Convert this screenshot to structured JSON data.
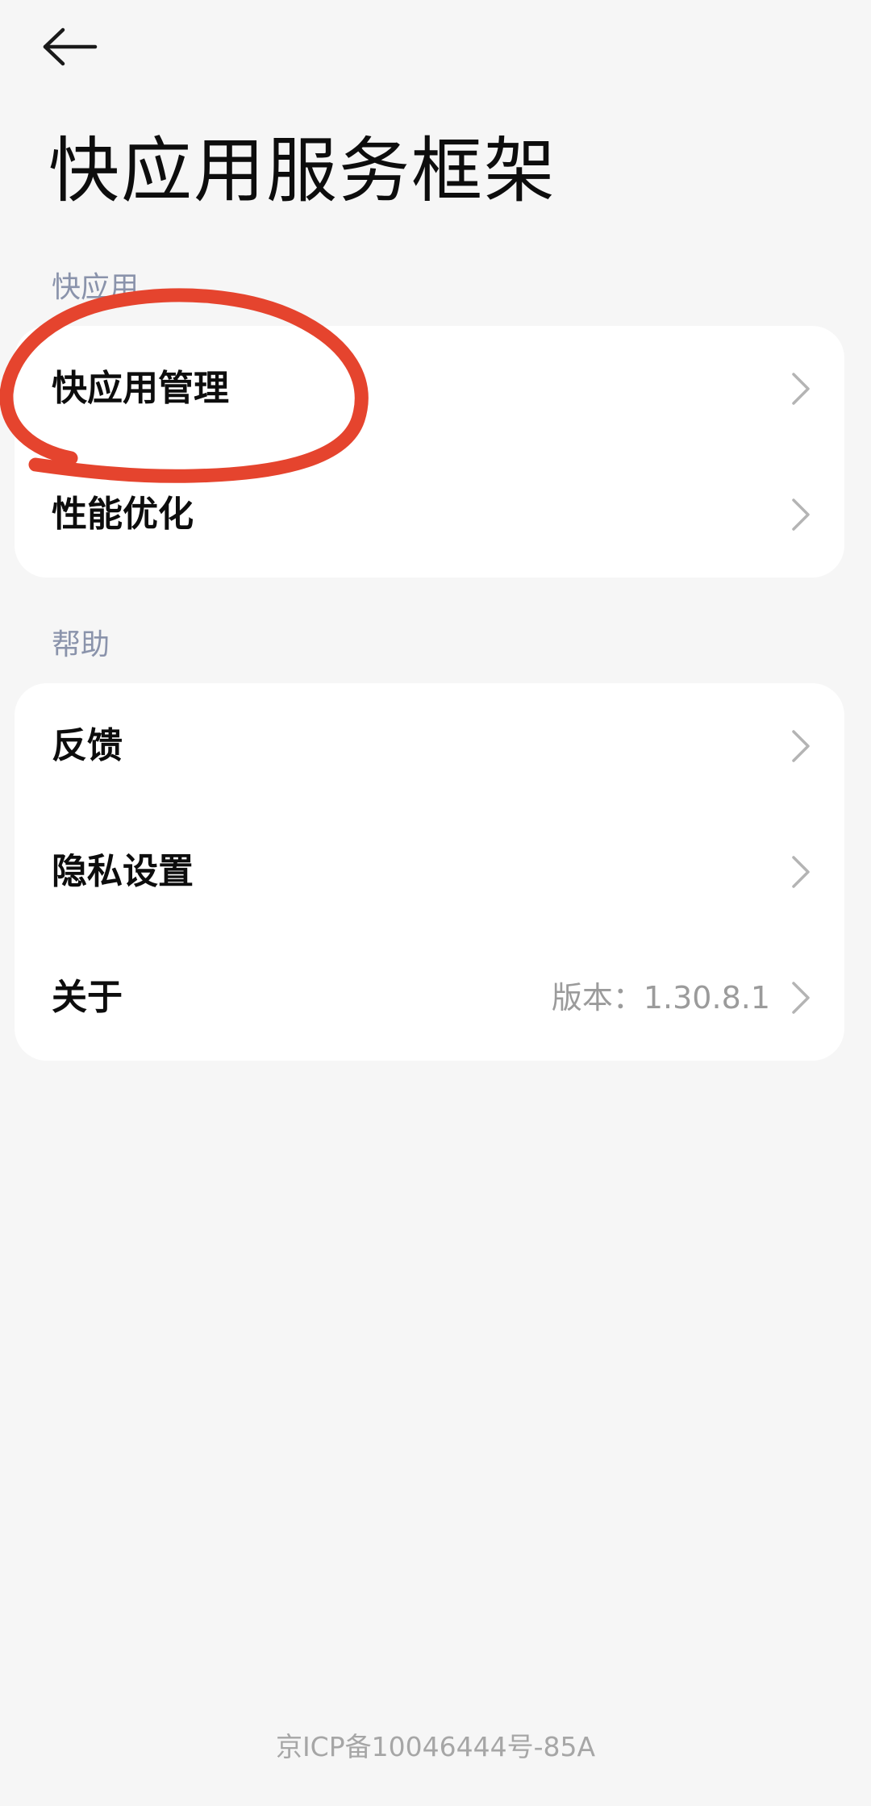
{
  "header": {
    "back_icon": "arrow-left-icon",
    "title": "快应用服务框架"
  },
  "sections": [
    {
      "title": "快应用",
      "items": [
        {
          "label": "快应用管理",
          "icon": "chevron-right-icon"
        },
        {
          "label": "性能优化",
          "icon": "chevron-right-icon"
        }
      ]
    },
    {
      "title": "帮助",
      "items": [
        {
          "label": "反馈",
          "icon": "chevron-right-icon"
        },
        {
          "label": "隐私设置",
          "icon": "chevron-right-icon"
        },
        {
          "label": "关于",
          "value": "版本：1.30.8.1",
          "icon": "chevron-right-icon"
        }
      ]
    }
  ],
  "footer": {
    "text": "京ICP备10046444号-85A"
  },
  "colors": {
    "background": "#f6f6f6",
    "card": "#ffffff",
    "section_header": "#8a93ab",
    "annotation": "#e5442e"
  }
}
